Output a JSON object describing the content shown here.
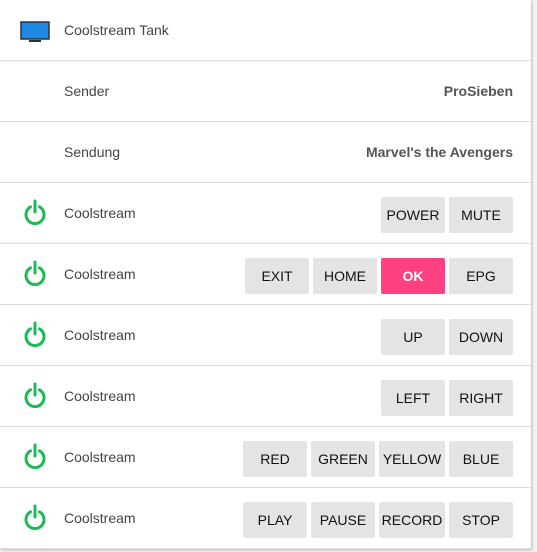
{
  "header": {
    "title": "Coolstream Tank",
    "icon": "monitor-icon"
  },
  "info_rows": [
    {
      "label": "Sender",
      "value": "ProSieben"
    },
    {
      "label": "Sendung",
      "value": "Marvel's the Avengers"
    }
  ],
  "power_icon_color": "#1db954",
  "accent_color": "#ff4081",
  "remote_rows": [
    {
      "label": "Coolstream",
      "buttons": [
        "POWER",
        "MUTE"
      ]
    },
    {
      "label": "Coolstream",
      "buttons": [
        "EXIT",
        "HOME",
        "OK",
        "EPG"
      ]
    },
    {
      "label": "Coolstream",
      "buttons": [
        "UP",
        "DOWN"
      ]
    },
    {
      "label": "Coolstream",
      "buttons": [
        "LEFT",
        "RIGHT"
      ]
    },
    {
      "label": "Coolstream",
      "buttons": [
        "RED",
        "GREEN",
        "YELLOW",
        "BLUE"
      ]
    },
    {
      "label": "Coolstream",
      "buttons": [
        "PLAY",
        "PAUSE",
        "RECORD",
        "STOP"
      ]
    }
  ]
}
